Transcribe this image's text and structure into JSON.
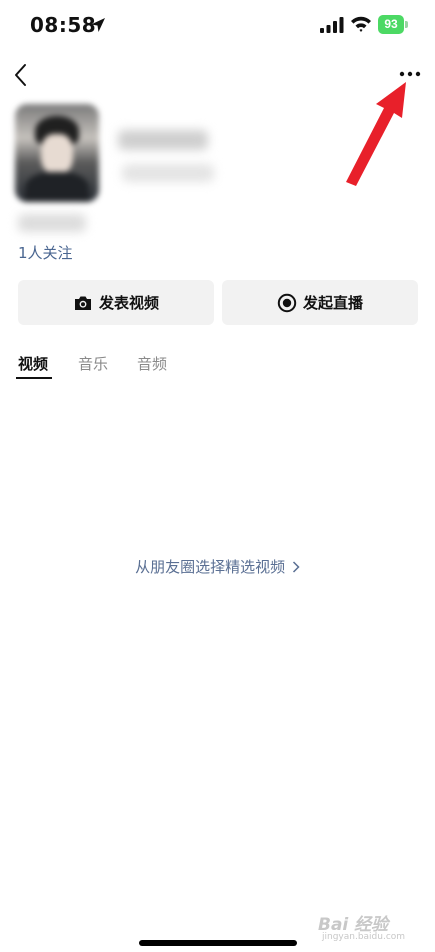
{
  "status_bar": {
    "time": "08:58",
    "battery": "93"
  },
  "nav": {
    "back_icon": "chevron-left-icon",
    "more_icon": "ellipsis-icon"
  },
  "profile": {
    "follow_text": "1人关注"
  },
  "actions": {
    "post_video_label": "发表视频",
    "go_live_label": "发起直播"
  },
  "tabs": [
    {
      "label": "视频",
      "active": true
    },
    {
      "label": "音乐",
      "active": false
    },
    {
      "label": "音频",
      "active": false
    }
  ],
  "content": {
    "select_link": "从朋友圈选择精选视频"
  },
  "watermark": {
    "main": "Bai 经验",
    "sub": "jingyan.baidu.com"
  },
  "colors": {
    "link_blue": "#4a6691",
    "annotation_red": "#e8202a",
    "battery_green": "#4cd964"
  }
}
